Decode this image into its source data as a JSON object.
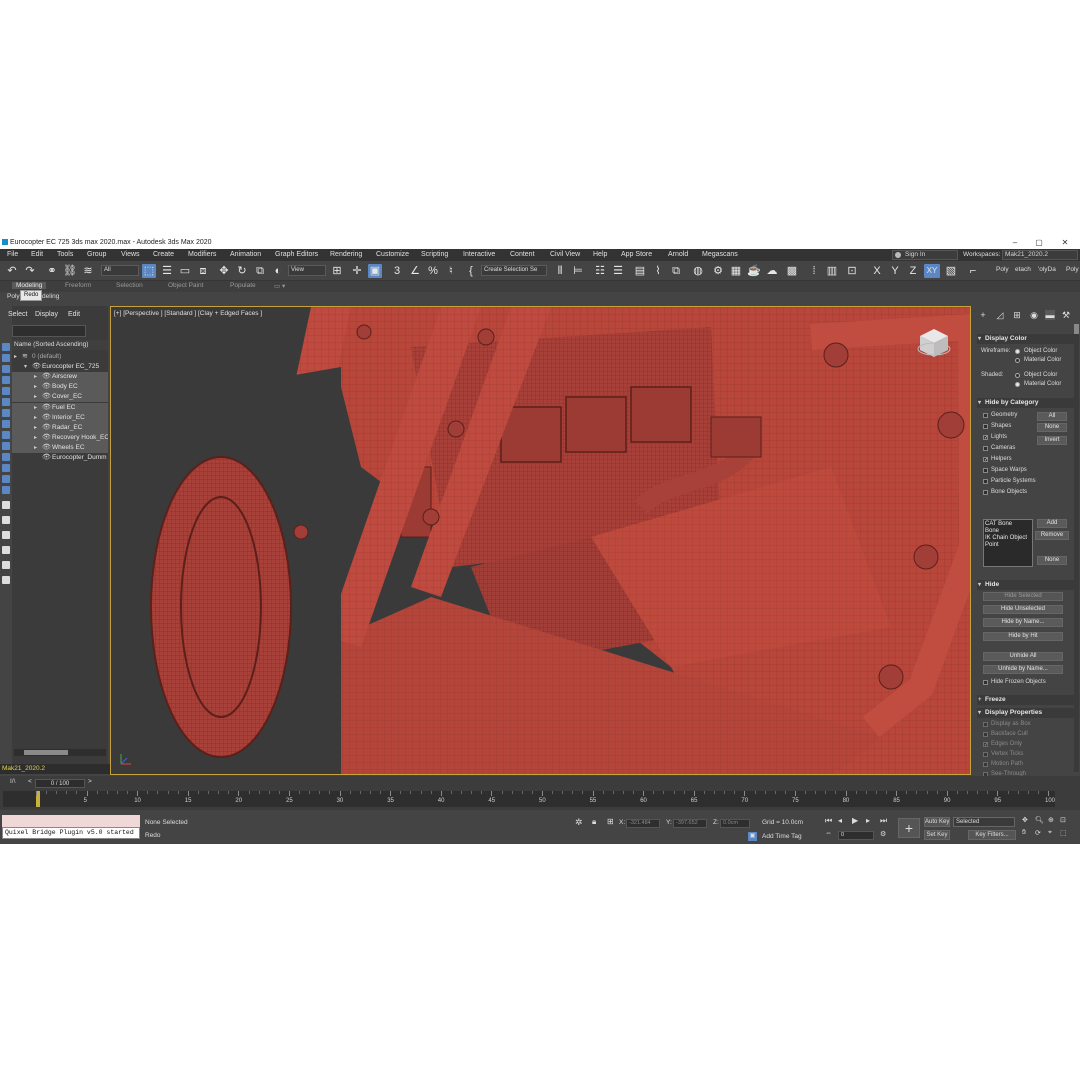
{
  "window": {
    "title": "Eurocopter EC 725 3ds max 2020.max - Autodesk 3ds Max 2020",
    "minimize": "‒",
    "maximize": "▢",
    "close": "✕"
  },
  "menu": [
    "File",
    "Edit",
    "Tools",
    "Group",
    "Views",
    "Create",
    "Modifiers",
    "Animation",
    "Graph Editors",
    "Rendering",
    "Customize",
    "Scripting",
    "Interactive",
    "Content",
    "Civil View",
    "Help",
    "App Store",
    "Arnold",
    "Megascans"
  ],
  "account": {
    "signin": "Sign In",
    "workspaces_label": "Workspaces:",
    "workspace": "Mak21_2020.2"
  },
  "toolbar": {
    "filter_select": "All",
    "refcoord_select": "View",
    "named_selection": "Create Selection Se",
    "axis_x": "X",
    "axis_y": "Y",
    "axis_z": "Z",
    "axis_xy": "XY",
    "poly_tabs": [
      "Poly",
      "etach",
      "'olyDa",
      "Poly"
    ]
  },
  "ribbon": {
    "tabs": [
      "Modeling",
      "Freeform",
      "Selection",
      "Object Paint",
      "Populate"
    ],
    "subtitle_left": "Poly",
    "subtitle_right": "deling",
    "tooltip": "Redo"
  },
  "scene_explorer": {
    "menu": [
      "Select",
      "Display",
      "Edit"
    ],
    "column_header": "Name (Sorted Ascending)",
    "rows": [
      {
        "label": "0 (default)",
        "indent": 0,
        "muted": true
      },
      {
        "label": "Eurocopter EC_725",
        "indent": 1,
        "muted": false
      },
      {
        "label": "Airscrew",
        "indent": 2,
        "muted": false
      },
      {
        "label": "Body EC",
        "indent": 2,
        "muted": false
      },
      {
        "label": "Cover_EC",
        "indent": 2,
        "muted": false
      },
      {
        "label": "Fuel EC",
        "indent": 2,
        "muted": false
      },
      {
        "label": "Interior_EC",
        "indent": 2,
        "muted": false
      },
      {
        "label": "Radar_EC",
        "indent": 2,
        "muted": false
      },
      {
        "label": "Recovery Hook_EC",
        "indent": 2,
        "muted": false
      },
      {
        "label": "Wheels EC",
        "indent": 2,
        "muted": false
      },
      {
        "label": "Eurocopter_Dumm",
        "indent": 2,
        "muted": false
      }
    ],
    "layer": "Mak21_2020.2"
  },
  "viewport": {
    "label": "[+] [Perspective ] [Standard ] [Clay + Edged Faces ]",
    "model_color": "#b8463a",
    "wire_color": "#7a2a22"
  },
  "command_panel": {
    "display_color": {
      "title": "Display Color",
      "wireframe_label": "Wireframe:",
      "shaded_label": "Shaded:",
      "object_color": "Object Color",
      "material_color": "Material Color"
    },
    "hide_by_category": {
      "title": "Hide by Category",
      "items": [
        {
          "label": "Geometry",
          "checked": false
        },
        {
          "label": "Shapes",
          "checked": false
        },
        {
          "label": "Lights",
          "checked": true
        },
        {
          "label": "Cameras",
          "checked": false
        },
        {
          "label": "Helpers",
          "checked": true
        },
        {
          "label": "Space Warps",
          "checked": false
        },
        {
          "label": "Particle Systems",
          "checked": false
        },
        {
          "label": "Bone Objects",
          "checked": false
        }
      ],
      "all": "All",
      "none": "None",
      "invert": "Invert",
      "list": [
        "CAT Bone",
        "Bone",
        "IK Chain Object",
        "Point"
      ],
      "add": "Add",
      "remove": "Remove",
      "none2": "None"
    },
    "hide": {
      "title": "Hide",
      "buttons": [
        "Hide Selected",
        "Hide Unselected",
        "Hide by Name...",
        "Hide by Hit",
        "Unhide All",
        "Unhide by Name..."
      ],
      "hide_frozen": "Hide Frozen Objects"
    },
    "freeze_title": "Freeze",
    "display_properties": {
      "title": "Display Properties",
      "items": [
        {
          "label": "Display as Box",
          "checked": false
        },
        {
          "label": "Backface Cull",
          "checked": false
        },
        {
          "label": "Edges Only",
          "checked": true
        },
        {
          "label": "Vertex Ticks",
          "checked": false
        },
        {
          "label": "Motion Path",
          "checked": false
        },
        {
          "label": "See-Through",
          "checked": false
        }
      ]
    }
  },
  "timeline": {
    "frame": "0 / 100",
    "ticks": [
      "0",
      "5",
      "10",
      "15",
      "20",
      "25",
      "30",
      "35",
      "40",
      "45",
      "50",
      "55",
      "60",
      "65",
      "70",
      "75",
      "80",
      "85",
      "90",
      "95",
      "100"
    ]
  },
  "status": {
    "listener_text": "Quixel Bridge Plugin v5.0 started",
    "selection": "None Selected",
    "prompt": "Redo",
    "x_label": "X:",
    "x_value": "-321.484",
    "y_label": "Y:",
    "y_value": "-397.652",
    "z_label": "Z:",
    "z_value": "0.0cm",
    "grid": "Grid = 10.0cm",
    "add_time_tag": "Add Time Tag",
    "auto_key": "Auto Key",
    "set_key": "Set Key",
    "selected": "Selected",
    "key_filters": "Key Filters...",
    "current_frame": "0"
  }
}
